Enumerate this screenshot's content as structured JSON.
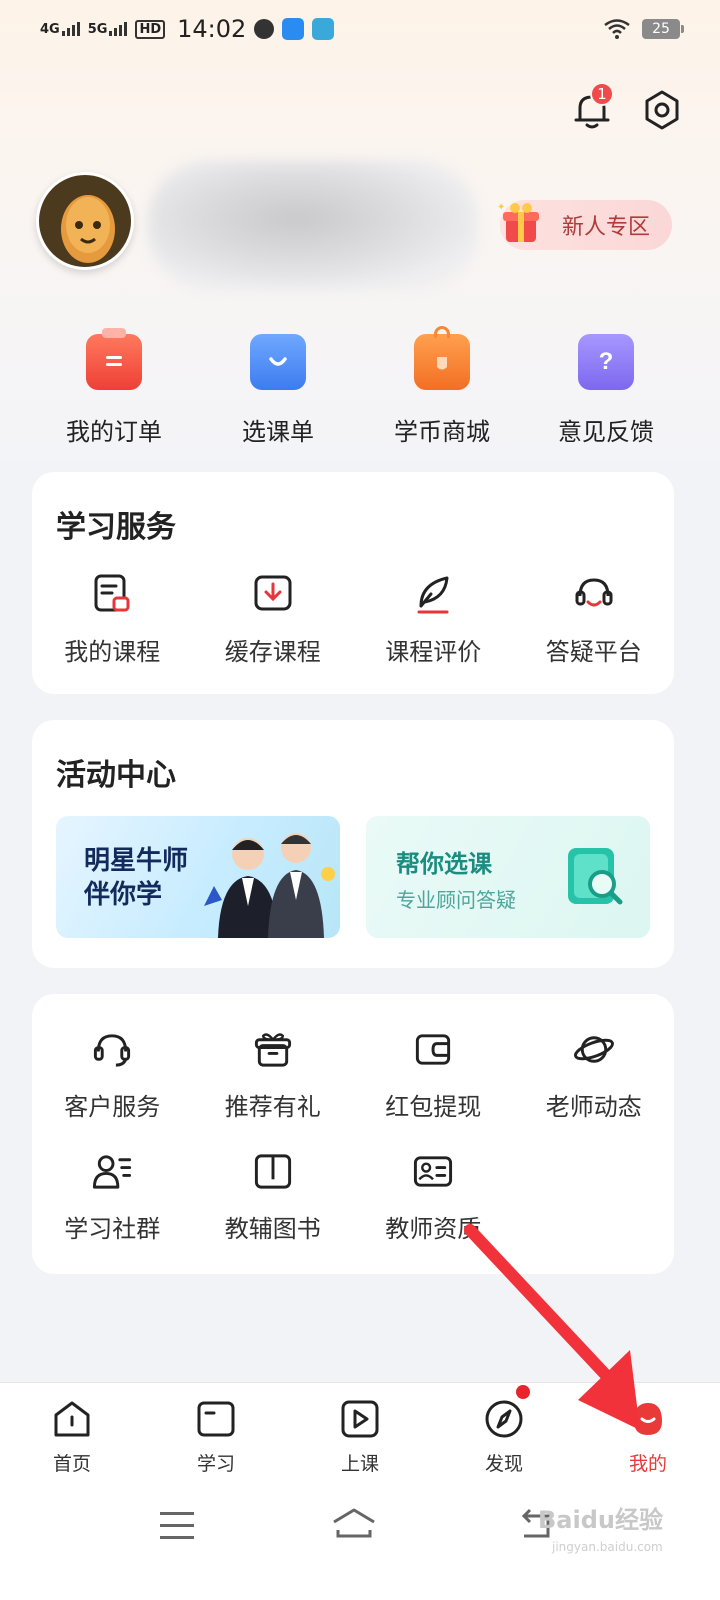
{
  "status_bar": {
    "network1": "4G",
    "network2": "5G",
    "hd": "HD",
    "time": "14:02",
    "battery": "25"
  },
  "header": {
    "notification_count": "1"
  },
  "profile": {
    "newbie_label": "新人专区"
  },
  "quick_actions": [
    {
      "label": "我的订单",
      "icon": "clipboard-icon",
      "color": "#f25a45"
    },
    {
      "label": "选课单",
      "icon": "bag-icon",
      "color": "#4d8df5"
    },
    {
      "label": "学币商城",
      "icon": "shop-icon",
      "color": "#f7873a"
    },
    {
      "label": "意见反馈",
      "icon": "question-icon",
      "color": "#8f7cf0"
    }
  ],
  "study_services": {
    "title": "学习服务",
    "items": [
      {
        "label": "我的课程",
        "icon": "course-icon"
      },
      {
        "label": "缓存课程",
        "icon": "download-icon"
      },
      {
        "label": "课程评价",
        "icon": "feather-icon"
      },
      {
        "label": "答疑平台",
        "icon": "headset-icon"
      }
    ]
  },
  "activity_center": {
    "title": "活动中心",
    "banner1": {
      "text": "明星牛师伴你学"
    },
    "banner2": {
      "title": "帮你选课",
      "subtitle": "专业顾问答疑"
    }
  },
  "more_services": {
    "items": [
      {
        "label": "客户服务",
        "icon": "headphones-icon"
      },
      {
        "label": "推荐有礼",
        "icon": "gift-icon"
      },
      {
        "label": "红包提现",
        "icon": "wallet-icon"
      },
      {
        "label": "老师动态",
        "icon": "planet-icon"
      },
      {
        "label": "学习社群",
        "icon": "community-icon"
      },
      {
        "label": "教辅图书",
        "icon": "book-icon"
      },
      {
        "label": "教师资质",
        "icon": "id-card-icon"
      }
    ]
  },
  "tabbar": {
    "tabs": [
      {
        "label": "首页",
        "icon": "home-icon"
      },
      {
        "label": "学习",
        "icon": "study-icon"
      },
      {
        "label": "上课",
        "icon": "play-icon"
      },
      {
        "label": "发现",
        "icon": "compass-icon"
      },
      {
        "label": "我的",
        "icon": "profile-icon"
      }
    ],
    "active_color": "#e93a3a"
  },
  "watermark": {
    "text": "Baidu经验",
    "sub": "jingyan.baidu.com"
  }
}
